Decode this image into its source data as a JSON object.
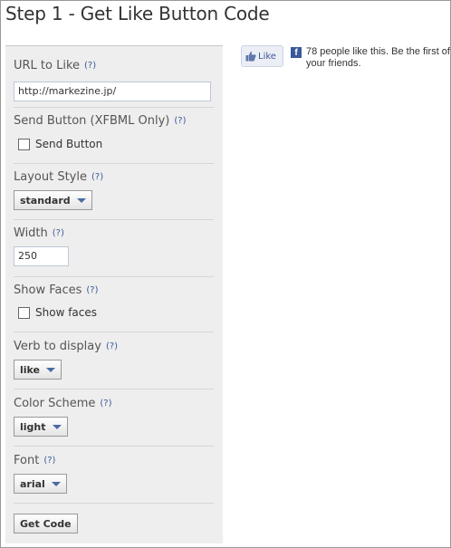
{
  "page": {
    "title": "Step 1 - Get Like Button Code"
  },
  "form": {
    "url": {
      "label": "URL to Like",
      "help": "(?)",
      "value": "http://markezine.jp/"
    },
    "send": {
      "label": "Send Button (XFBML Only)",
      "help": "(?)",
      "checkbox_label": "Send Button",
      "checked": false
    },
    "layout": {
      "label": "Layout Style",
      "help": "(?)",
      "value": "standard"
    },
    "width": {
      "label": "Width",
      "help": "(?)",
      "value": "250"
    },
    "faces": {
      "label": "Show Faces",
      "help": "(?)",
      "checkbox_label": "Show faces",
      "checked": false
    },
    "verb": {
      "label": "Verb to display",
      "help": "(?)",
      "value": "like"
    },
    "color": {
      "label": "Color Scheme",
      "help": "(?)",
      "value": "light"
    },
    "font": {
      "label": "Font",
      "help": "(?)",
      "value": "arial"
    },
    "submit_label": "Get Code"
  },
  "preview": {
    "like_button_label": "Like",
    "fb_icon_glyph": "f",
    "social_text": "78 people like this. Be the first of your friends."
  },
  "colors": {
    "link": "#3b5998",
    "panel": "#eeeeee",
    "like_button_bg": "#eceef5"
  },
  "icons": {
    "like": "thumbs-up-icon",
    "facebook": "facebook-icon",
    "dropdown": "chevron-down-icon"
  }
}
